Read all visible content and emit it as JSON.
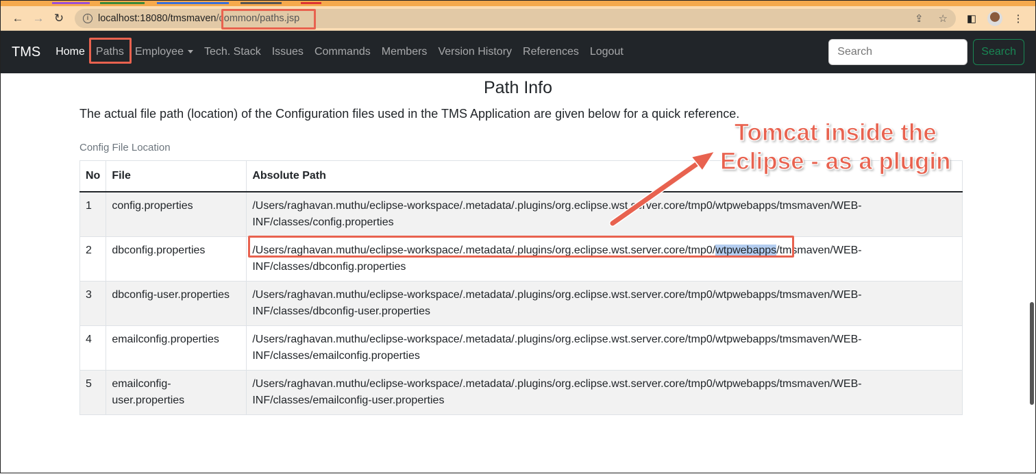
{
  "browser": {
    "url_host": "localhost:18080/tmsmaven",
    "url_path": "/common/paths.jsp"
  },
  "nav": {
    "brand": "TMS",
    "items": [
      "Home",
      "Paths",
      "Employee",
      "Tech. Stack",
      "Issues",
      "Commands",
      "Members",
      "Version History",
      "References",
      "Logout"
    ],
    "active": "Paths",
    "search_placeholder": "Search",
    "search_button": "Search"
  },
  "page": {
    "title": "Path Info",
    "lead": "The actual file path (location) of the Configuration files used in the TMS Application are given below for a quick reference.",
    "caption": "Config File Location"
  },
  "table": {
    "headers": [
      "No",
      "File",
      "Absolute Path"
    ],
    "rows": [
      {
        "no": "1",
        "file": "config.properties",
        "path": "/Users/raghavan.muthu/eclipse-workspace/.metadata/.plugins/org.eclipse.wst.server.core/tmp0/wtpwebapps/tmsmaven/WEB-INF/classes/config.properties"
      },
      {
        "no": "2",
        "file": "dbconfig.properties",
        "path_a": "/Users/raghavan.muthu/eclipse-workspace/.metadata/.plugins/org.eclipse.wst.server.core/tmp0/",
        "path_hl": "wtpwebapps",
        "path_b": "/tmsmaven/WEB-INF/classes/dbconfig.properties"
      },
      {
        "no": "3",
        "file": "dbconfig-user.properties",
        "path": "/Users/raghavan.muthu/eclipse-workspace/.metadata/.plugins/org.eclipse.wst.server.core/tmp0/wtpwebapps/tmsmaven/WEB-INF/classes/dbconfig-user.properties"
      },
      {
        "no": "4",
        "file": "emailconfig.properties",
        "path": "/Users/raghavan.muthu/eclipse-workspace/.metadata/.plugins/org.eclipse.wst.server.core/tmp0/wtpwebapps/tmsmaven/WEB-INF/classes/emailconfig.properties"
      },
      {
        "no": "5",
        "file": "emailconfig-user.properties",
        "path": "/Users/raghavan.muthu/eclipse-workspace/.metadata/.plugins/org.eclipse.wst.server.core/tmp0/wtpwebapps/tmsmaven/WEB-INF/classes/emailconfig-user.properties"
      }
    ]
  },
  "annotation": {
    "line1": "Tomcat inside the",
    "line2": "Eclipse - as a plugin",
    "color": "#e8624f"
  }
}
